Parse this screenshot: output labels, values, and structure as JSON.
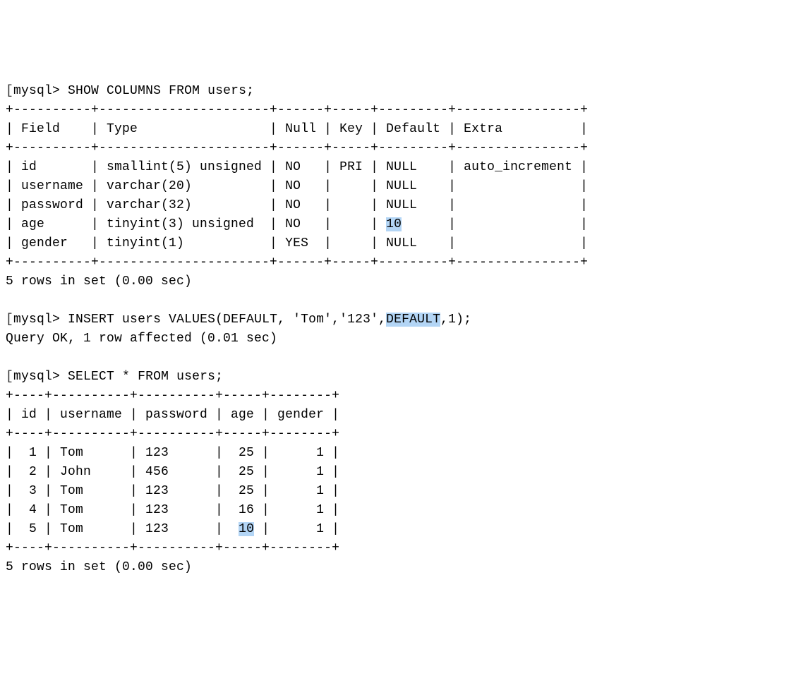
{
  "prompt": "mysql>",
  "bracket": "[",
  "commands": {
    "show_columns": "SHOW COLUMNS FROM users;",
    "insert": {
      "prefix": "INSERT users VALUES(DEFAULT, 'Tom','123',",
      "highlighted": "DEFAULT",
      "suffix": ",1);"
    },
    "select": "SELECT * FROM users;"
  },
  "responses": {
    "query_ok": "Query OK, 1 row affected (0.01 sec)",
    "rows_in_set": "5 rows in set (0.00 sec)"
  },
  "columns_table": {
    "border_top": "+----------+----------------------+------+-----+---------+----------------+",
    "border_mid": "+----------+----------------------+------+-----+---------+----------------+",
    "border_bottom": "+----------+----------------------+------+-----+---------+----------------+",
    "header": "| Field    | Type                 | Null | Key | Default | Extra          |",
    "rows": [
      "| id       | smallint(5) unsigned | NO   | PRI | NULL    | auto_increment |",
      "| username | varchar(20)          | NO   |     | NULL    |                |",
      "| password | varchar(32)          | NO   |     | NULL    |                |"
    ],
    "age_row": {
      "prefix": "| age      | tinyint(3) unsigned  | NO   |     | ",
      "highlighted": "10",
      "suffix": "      |                |"
    },
    "rows_after": [
      "| gender   | tinyint(1)           | YES  |     | NULL    |                |"
    ]
  },
  "select_table": {
    "border_top": "+----+----------+----------+-----+--------+",
    "border_mid": "+----+----------+----------+-----+--------+",
    "border_bottom": "+----+----------+----------+-----+--------+",
    "header": "| id | username | password | age | gender |",
    "rows": [
      "|  1 | Tom      | 123      |  25 |      1 |",
      "|  2 | John     | 456      |  25 |      1 |",
      "|  3 | Tom      | 123      |  25 |      1 |",
      "|  4 | Tom      | 123      |  16 |      1 |"
    ],
    "last_row": {
      "prefix": "|  5 | Tom      | 123      |  ",
      "highlighted": "10",
      "suffix": " |      1 |"
    }
  }
}
